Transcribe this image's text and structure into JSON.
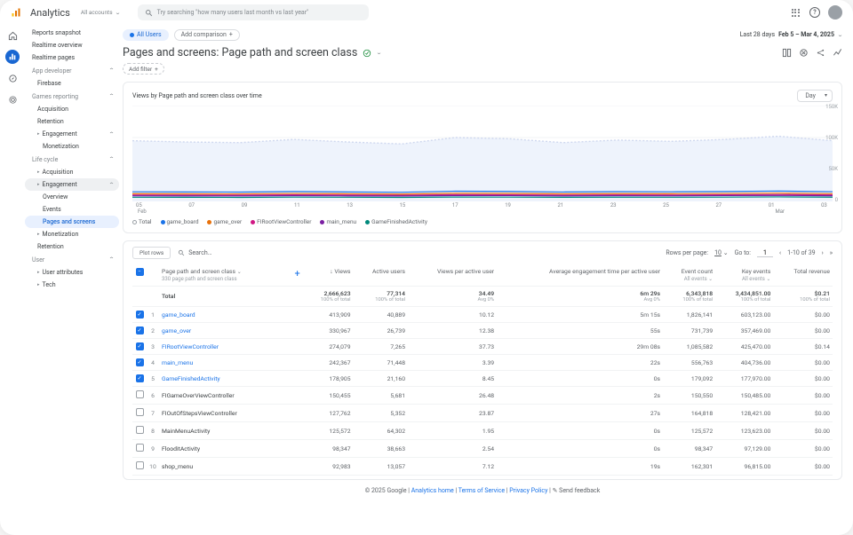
{
  "brand": "Analytics",
  "accounts": "All accounts",
  "search": {
    "placeholder": "Try searching \"how many users last month vs last year\""
  },
  "rail": [
    "home",
    "reports",
    "explore",
    "ads",
    "admin"
  ],
  "nav": {
    "top": [
      "Reports snapshot",
      "Realtime overview",
      "Realtime pages"
    ],
    "groups": [
      {
        "label": "App developer",
        "items": [
          "Firebase"
        ]
      },
      {
        "label": "Games reporting",
        "items": [
          "Acquisition",
          "Retention"
        ],
        "sub": [
          {
            "label": "Engagement",
            "items": [
              "Monetization"
            ]
          }
        ]
      },
      {
        "label": "Life cycle",
        "items2": [
          {
            "label": "Acquisition",
            "bullet": true
          },
          {
            "label": "Engagement",
            "pill": true,
            "bullet": true,
            "children": [
              "Overview",
              "Events",
              "Pages and screens"
            ]
          },
          {
            "label": "Monetization",
            "bullet": true
          },
          {
            "label": "Retention"
          }
        ]
      },
      {
        "label": "User",
        "items2": [
          {
            "label": "User attributes",
            "bullet": true
          },
          {
            "label": "Tech",
            "bullet": true
          }
        ]
      }
    ]
  },
  "audience_chip": "All Users",
  "add_comparison": "Add comparison",
  "date_range": {
    "label": "Last 28 days",
    "range": "Feb 5 – Mar 4, 2025"
  },
  "page_title": "Pages and screens: Page path and screen class",
  "add_filter": "Add filter",
  "chart": {
    "title": "Views by Page path and screen class over time",
    "picker": "Day",
    "ylabels": [
      "150K",
      "100K",
      "50K",
      "0"
    ],
    "xlabels_top": [
      "05",
      "07",
      "09",
      "11",
      "13",
      "15",
      "17",
      "19",
      "21",
      "23",
      "25",
      "27",
      "01",
      "03"
    ],
    "xlabels_sub": {
      "feb": "Feb",
      "mar": "Mar"
    },
    "legend": [
      {
        "name": "Total",
        "color": "#9aa0a6",
        "ring": true
      },
      {
        "name": "game_board",
        "color": "#1a73e8"
      },
      {
        "name": "game_over",
        "color": "#e8710a"
      },
      {
        "name": "FIRootViewController",
        "color": "#d01884"
      },
      {
        "name": "main_menu",
        "color": "#7b1fa2"
      },
      {
        "name": "GameFinishedActivity",
        "color": "#00897b"
      }
    ]
  },
  "chart_data": {
    "type": "line",
    "x": [
      "Feb 5",
      "Feb 7",
      "Feb 9",
      "Feb 11",
      "Feb 13",
      "Feb 15",
      "Feb 17",
      "Feb 19",
      "Feb 21",
      "Feb 23",
      "Feb 25",
      "Feb 27",
      "Mar 1",
      "Mar 3"
    ],
    "ylim": [
      0,
      150000
    ],
    "series": [
      {
        "name": "Total",
        "values": [
          95000,
          93000,
          92000,
          97000,
          93000,
          90000,
          100000,
          98000,
          92000,
          96000,
          94000,
          97000,
          102000,
          95000
        ]
      },
      {
        "name": "game_board",
        "values": [
          15000,
          14800,
          14600,
          15500,
          14800,
          14300,
          16000,
          15600,
          14700,
          15300,
          15000,
          15500,
          16200,
          15200
        ]
      },
      {
        "name": "game_over",
        "values": [
          12000,
          11800,
          11700,
          12400,
          11900,
          11500,
          12700,
          12500,
          11800,
          12200,
          12000,
          12400,
          12900,
          12100
        ]
      },
      {
        "name": "FIRootViewController",
        "values": [
          10000,
          9800,
          9700,
          10300,
          9900,
          9500,
          10500,
          10300,
          9800,
          10100,
          9900,
          10200,
          10700,
          10100
        ]
      },
      {
        "name": "main_menu",
        "values": [
          8800,
          8700,
          8600,
          9000,
          8700,
          8500,
          9200,
          9100,
          8700,
          9000,
          8800,
          9100,
          9400,
          8900
        ]
      },
      {
        "name": "GameFinishedActivity",
        "values": [
          6500,
          6400,
          6300,
          6700,
          6500,
          6300,
          6800,
          6700,
          6400,
          6600,
          6500,
          6700,
          7000,
          6600
        ]
      }
    ]
  },
  "table": {
    "plot_rows": "Plot rows",
    "search": "Search…",
    "rows_per_page_label": "Rows per page:",
    "rows_per_page": "10",
    "goto_label": "Go to:",
    "goto": "1",
    "range": "1-10 of 39",
    "dim_header": "Page path and screen class",
    "dim_sub": "330 page path and screen class",
    "cols": [
      {
        "label": "Views",
        "arrow": true
      },
      {
        "label": "Active users"
      },
      {
        "label": "Views per active user"
      },
      {
        "label": "Average engagement time per active user"
      },
      {
        "label": "Event count",
        "sub": "All events"
      },
      {
        "label": "Key events",
        "sub": "All events"
      },
      {
        "label": "Total revenue"
      }
    ],
    "total": {
      "name": "Total",
      "views": "2,666,623",
      "views_s": "100% of total",
      "au": "77,314",
      "au_s": "100% of total",
      "vpu": "34.49",
      "vpu_s": "Avg 0%",
      "aet": "6m 29s",
      "aet_s": "Avg 0%",
      "ec": "6,343,818",
      "ec_s": "100% of total",
      "ke": "3,434,851.00",
      "ke_s": "100% of total",
      "rev": "$0.21",
      "rev_s": "100% of total"
    },
    "rows": [
      {
        "c": true,
        "n": "game_board",
        "v": "413,909",
        "au": "40,889",
        "vpu": "10.12",
        "aet": "5m 15s",
        "ec": "1,826,141",
        "ke": "603,123.00",
        "rev": "$0.00"
      },
      {
        "c": true,
        "n": "game_over",
        "v": "330,967",
        "au": "26,739",
        "vpu": "12.38",
        "aet": "55s",
        "ec": "731,739",
        "ke": "357,469.00",
        "rev": "$0.00"
      },
      {
        "c": true,
        "n": "FIRootViewController",
        "v": "274,079",
        "au": "7,265",
        "vpu": "37.73",
        "aet": "29m 08s",
        "ec": "1,085,582",
        "ke": "425,470.00",
        "rev": "$0.14"
      },
      {
        "c": true,
        "n": "main_menu",
        "v": "242,367",
        "au": "71,448",
        "vpu": "3.39",
        "aet": "22s",
        "ec": "556,763",
        "ke": "404,736.00",
        "rev": "$0.00"
      },
      {
        "c": true,
        "n": "GameFinishedActivity",
        "v": "178,905",
        "au": "21,160",
        "vpu": "8.45",
        "aet": "0s",
        "ec": "179,092",
        "ke": "177,970.00",
        "rev": "$0.00"
      },
      {
        "c": false,
        "n": "FIGameOverViewController",
        "v": "150,455",
        "au": "5,681",
        "vpu": "26.48",
        "aet": "2s",
        "ec": "150,550",
        "ke": "150,485.00",
        "rev": "$0.00"
      },
      {
        "c": false,
        "n": "FIOutOfStepsViewController",
        "v": "127,762",
        "au": "5,352",
        "vpu": "23.87",
        "aet": "27s",
        "ec": "164,818",
        "ke": "128,421.00",
        "rev": "$0.00"
      },
      {
        "c": false,
        "n": "MainMenuActivity",
        "v": "125,572",
        "au": "64,302",
        "vpu": "1.95",
        "aet": "0s",
        "ec": "125,572",
        "ke": "123,623.00",
        "rev": "$0.00"
      },
      {
        "c": false,
        "n": "FlooditActivity",
        "v": "98,347",
        "au": "38,663",
        "vpu": "2.54",
        "aet": "0s",
        "ec": "98,347",
        "ke": "97,129.00",
        "rev": "$0.00"
      },
      {
        "c": false,
        "n": "shop_menu",
        "v": "92,983",
        "au": "13,057",
        "vpu": "7.12",
        "aet": "19s",
        "ec": "162,301",
        "ke": "96,815.00",
        "rev": "$0.00"
      }
    ]
  },
  "footer": {
    "copy": "© 2025 Google",
    "links": [
      "Analytics home",
      "Terms of Service",
      "Privacy Policy"
    ],
    "feedback": "Send feedback"
  }
}
